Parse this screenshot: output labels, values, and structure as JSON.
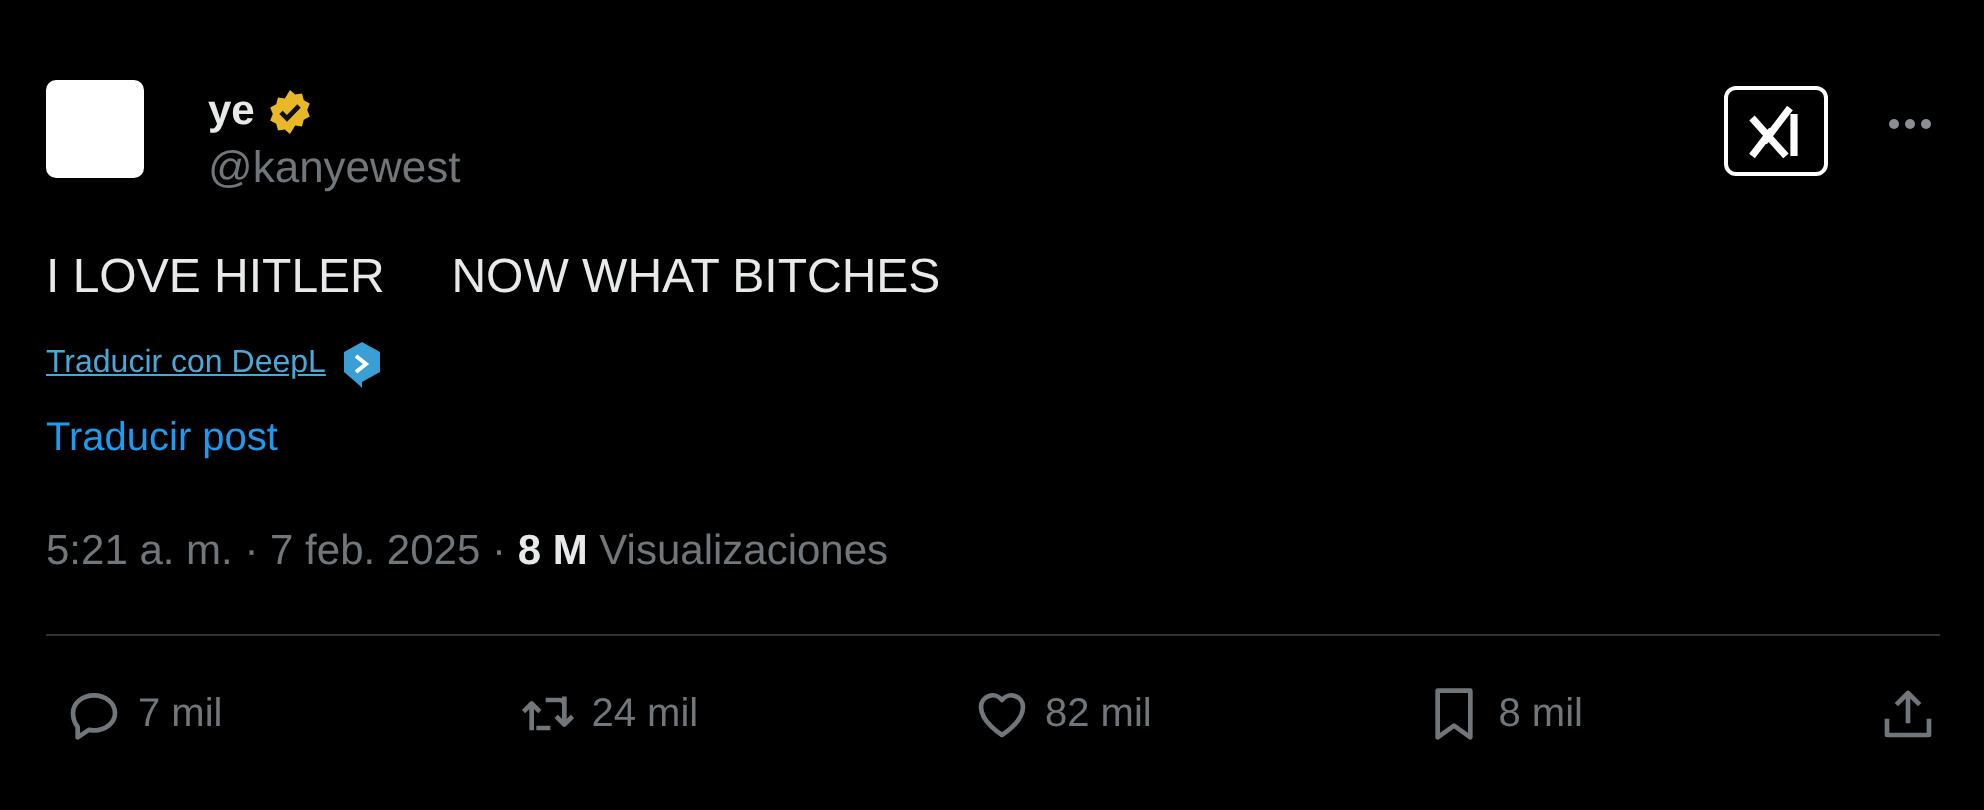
{
  "author": {
    "name": "ye",
    "verified": true,
    "handle": "@kanyewest"
  },
  "post": {
    "text": "I LOVE HITLER     NOW WHAT BITCHES"
  },
  "translate_links": [
    {
      "kind": "deepl",
      "label": "Traducir con DeepL"
    },
    {
      "kind": "plain",
      "label": "Traducir post"
    }
  ],
  "meta": "5:21 a. m. · 7 feb. 2025 · **8 M** Visualizaciones",
  "actions": [
    {
      "kind": "reply",
      "count": "7 mil"
    },
    {
      "kind": "repost",
      "count": "24 mil"
    },
    {
      "kind": "like",
      "count": "82 mil"
    },
    {
      "kind": "bookmark",
      "count": "8 mil"
    },
    {
      "kind": "share"
    }
  ]
}
